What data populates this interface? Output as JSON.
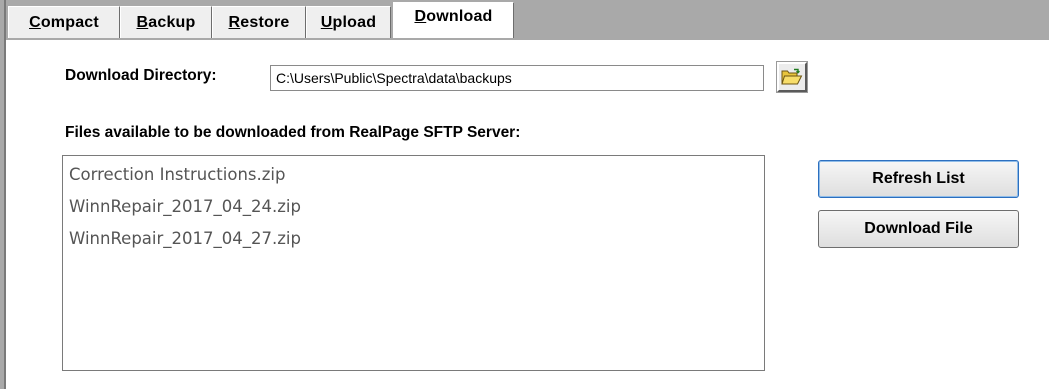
{
  "tabs": [
    {
      "mnemonic": "C",
      "rest": "ompact",
      "active": false
    },
    {
      "mnemonic": "B",
      "rest": "ackup",
      "active": false
    },
    {
      "mnemonic": "R",
      "rest": "estore",
      "active": false
    },
    {
      "mnemonic": "U",
      "rest": "pload",
      "active": false
    },
    {
      "mnemonic": "D",
      "rest": "ownload",
      "active": true
    }
  ],
  "download": {
    "directory_label": "Download Directory:",
    "directory_value": "C:\\Users\\Public\\Spectra\\data\\backups",
    "browse_icon": "open-folder-icon",
    "files_label": "Files available to be downloaded from RealPage SFTP Server:",
    "files": [
      "Correction Instructions.zip",
      "WinnRepair_2017_04_24.zip",
      "WinnRepair_2017_04_27.zip"
    ],
    "refresh_label": "Refresh List",
    "download_label": "Download File"
  },
  "colors": {
    "tabstrip_background": "#a9a9a9",
    "default_button_border": "#2c6fbf",
    "list_text": "#555555"
  }
}
